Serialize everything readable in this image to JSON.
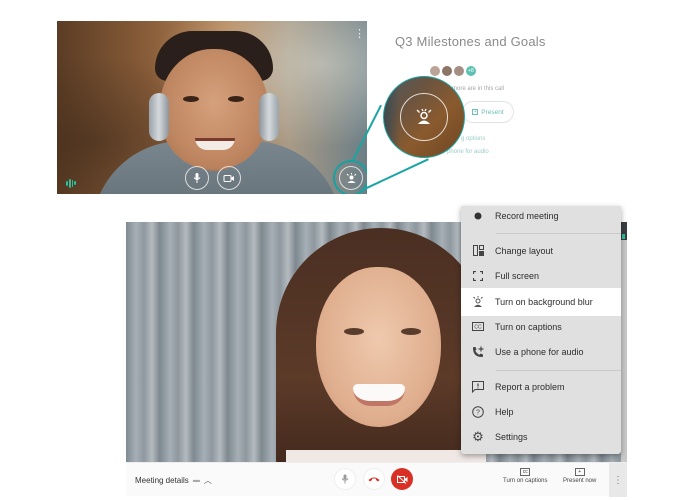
{
  "top_call": {
    "more_icon": "⋮",
    "controls": {
      "mic_icon": "microphone-icon",
      "camera_icon": "camera-icon",
      "blur_icon": "background-blur-icon"
    },
    "audio_indicator": "equalizer-icon"
  },
  "info_panel": {
    "title": "Q3 Milestones and Goals",
    "more_participants_badge": "+8",
    "in_call_text": "more are in this call",
    "present_label": "Present",
    "options_text": "g options",
    "phone_text": "phone for audio"
  },
  "menu": {
    "items": [
      {
        "label": "Record meeting",
        "icon": "record-icon",
        "glyph": "●"
      },
      {
        "label": "Change layout",
        "icon": "layout-icon",
        "glyph": "▯▪"
      },
      {
        "label": "Full screen",
        "icon": "fullscreen-icon",
        "glyph": "⛶"
      },
      {
        "label": "Turn on background blur",
        "icon": "background-blur-icon",
        "glyph": "◎",
        "active": true
      },
      {
        "label": "Turn on captions",
        "icon": "captions-icon",
        "glyph": "CC"
      },
      {
        "label": "Use a phone for audio",
        "icon": "phone-add-icon",
        "glyph": "☏"
      },
      {
        "label": "Report a problem",
        "icon": "report-icon",
        "glyph": "!"
      },
      {
        "label": "Help",
        "icon": "help-icon",
        "glyph": "?"
      },
      {
        "label": "Settings",
        "icon": "settings-icon",
        "glyph": "⚙"
      }
    ]
  },
  "toolbar": {
    "meeting_details": "Meeting details",
    "captions_label": "Turn on captions",
    "present_label": "Present now",
    "more_icon": "⋮"
  },
  "colors": {
    "accent": "#17a2a0",
    "danger": "#d93025",
    "menu_bg": "#e0e0e0"
  }
}
